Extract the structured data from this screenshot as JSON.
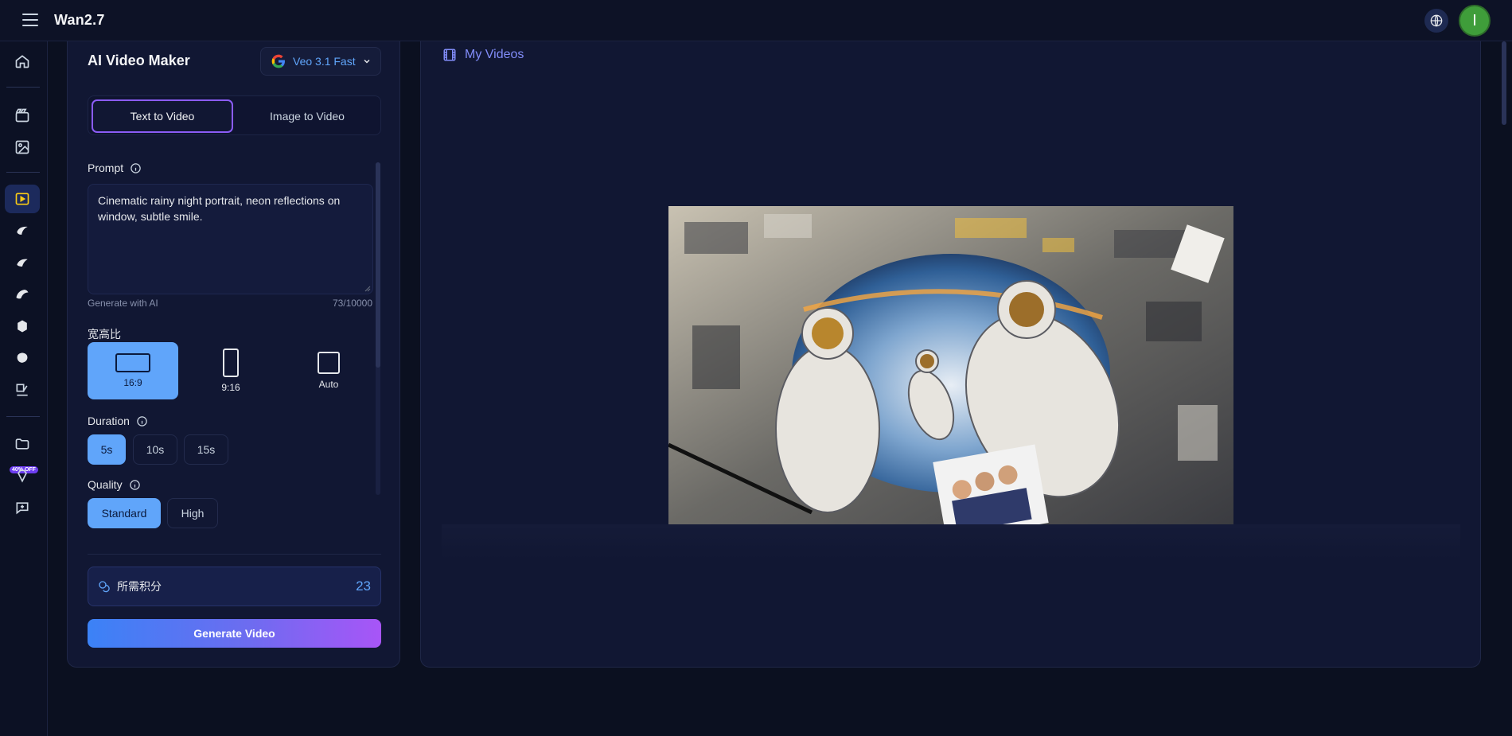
{
  "app": {
    "title": "Wan2.7",
    "avatar_initial": "I"
  },
  "rail": {
    "items": [
      {
        "name": "home-icon"
      },
      {
        "name": "video-clapper-icon"
      },
      {
        "name": "image-icon"
      },
      {
        "name": "video-play-icon",
        "active": true
      },
      {
        "name": "model-icon-a"
      },
      {
        "name": "model-icon-b"
      },
      {
        "name": "model-icon-c"
      },
      {
        "name": "model-icon-d"
      },
      {
        "name": "model-icon-e"
      },
      {
        "name": "edit-icon"
      },
      {
        "name": "folder-icon"
      },
      {
        "name": "diamond-icon"
      },
      {
        "name": "support-chat-icon"
      }
    ],
    "discount_badge": "40% OFF"
  },
  "panel": {
    "title": "AI Video Maker",
    "model": {
      "label": "Veo 3.1 Fast",
      "brand_icon": "google-icon"
    },
    "tabs": [
      {
        "label": "Text to Video",
        "active": true
      },
      {
        "label": "Image to Video",
        "active": false
      }
    ],
    "prompt": {
      "label": "Prompt",
      "value": "Cinematic rainy night portrait, neon reflections on window, subtle smile.",
      "generate_with_ai": "Generate with AI",
      "char_count": "73/10000"
    },
    "aspect_ratio": {
      "label": "宽高比",
      "options": [
        {
          "label": "16:9",
          "active": true
        },
        {
          "label": "9:16",
          "active": false
        },
        {
          "label": "Auto",
          "active": false
        }
      ]
    },
    "duration": {
      "label": "Duration",
      "options": [
        {
          "label": "5s",
          "active": true
        },
        {
          "label": "10s",
          "active": false
        },
        {
          "label": "15s",
          "active": false
        }
      ]
    },
    "quality": {
      "label": "Quality",
      "options": [
        {
          "label": "Standard",
          "active": true
        },
        {
          "label": "High",
          "active": false
        }
      ]
    },
    "credits": {
      "label": "所需积分",
      "value": "23"
    },
    "generate_label": "Generate Video"
  },
  "videos": {
    "title": "My Videos"
  },
  "colors": {
    "accent": "#60a5fa",
    "purple": "#8b5cf6",
    "background": "#0b1020",
    "panel": "#111733"
  }
}
